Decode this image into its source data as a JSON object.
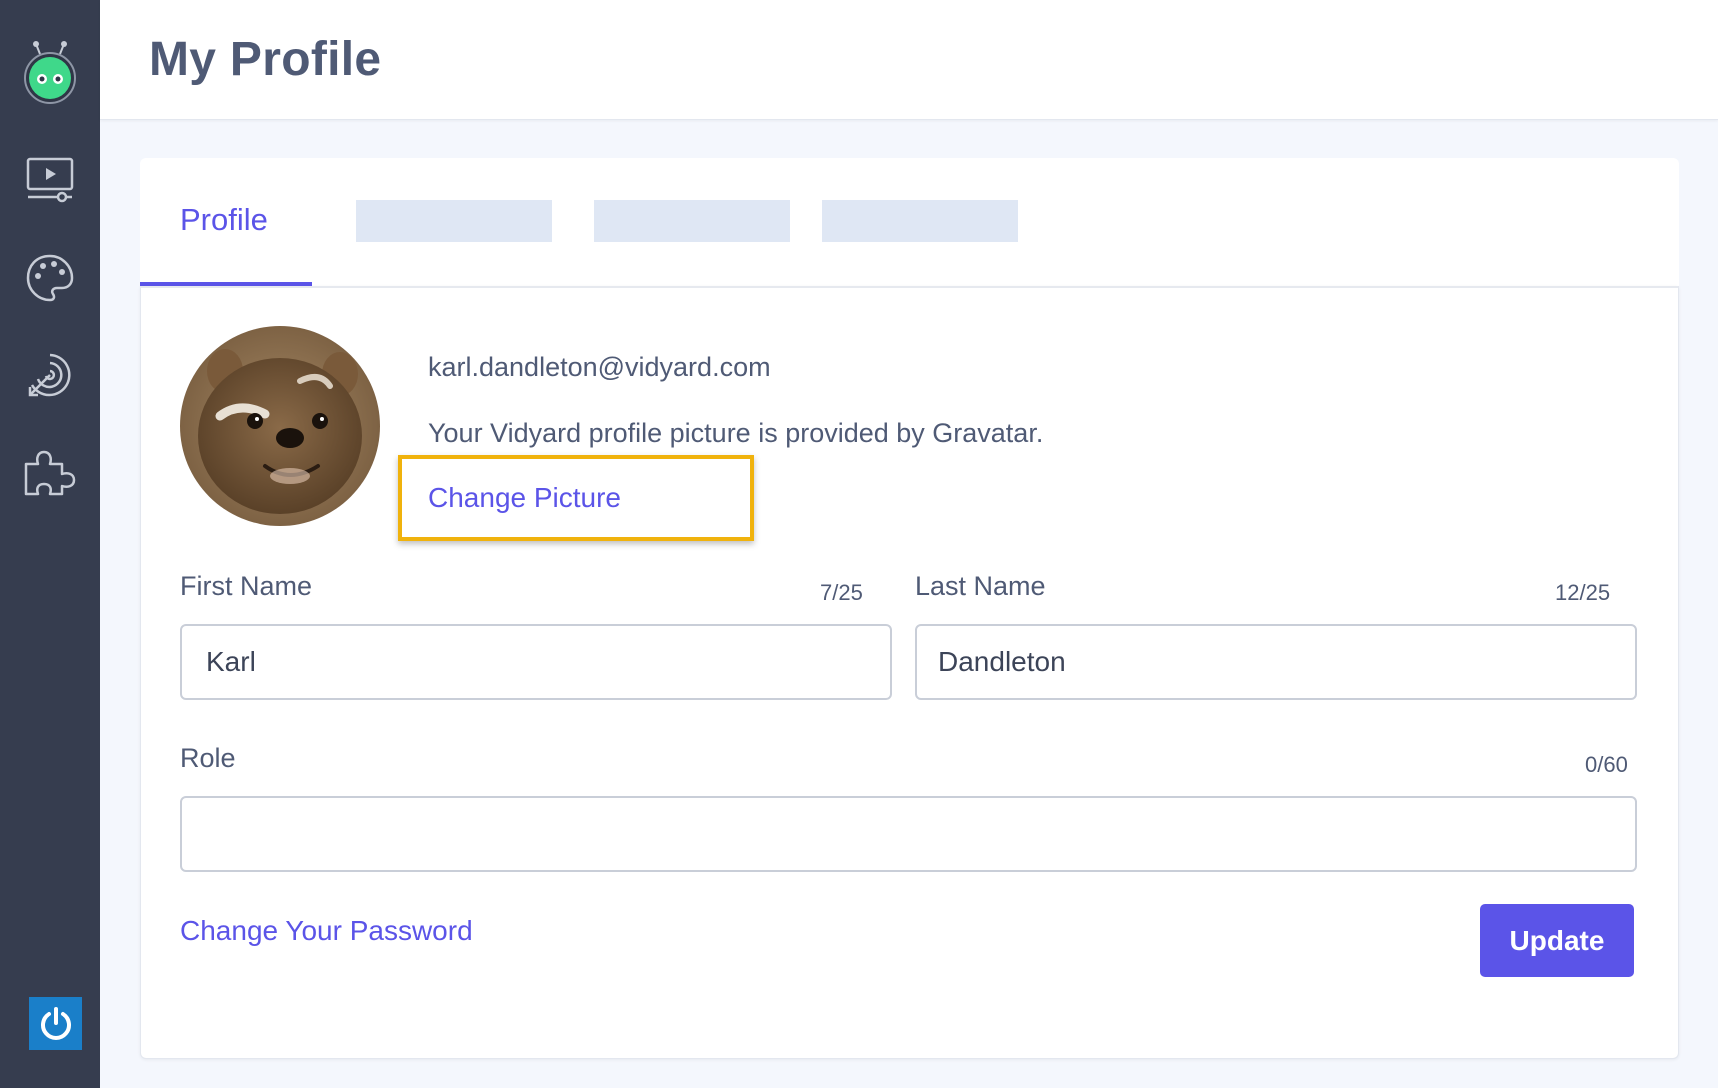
{
  "header": {
    "title": "My Profile"
  },
  "sidebar": {
    "items": [
      {
        "name": "logo",
        "icon": "bot-logo-icon"
      },
      {
        "name": "videos",
        "icon": "video-player-icon"
      },
      {
        "name": "branding",
        "icon": "palette-icon"
      },
      {
        "name": "analytics",
        "icon": "target-icon"
      },
      {
        "name": "integrations",
        "icon": "puzzle-icon"
      },
      {
        "name": "power",
        "icon": "power-icon"
      }
    ]
  },
  "tabs": [
    {
      "label": "Profile",
      "active": true
    }
  ],
  "profile": {
    "email": "karl.dandleton@vidyard.com",
    "gravatar_note": "Your Vidyard profile picture is provided by Gravatar.",
    "change_picture_label": "Change Picture"
  },
  "form": {
    "first_name": {
      "label": "First Name",
      "counter": "7/25",
      "value": "Karl"
    },
    "last_name": {
      "label": "Last Name",
      "counter": "12/25",
      "value": "Dandleton"
    },
    "role": {
      "label": "Role",
      "counter": "0/60",
      "value": ""
    },
    "change_password_label": "Change Your Password",
    "update_label": "Update"
  },
  "colors": {
    "accent": "#5b54e8",
    "sidebar": "#363d4f",
    "highlight": "#f0b20c",
    "power_button": "#1a7fc9"
  }
}
